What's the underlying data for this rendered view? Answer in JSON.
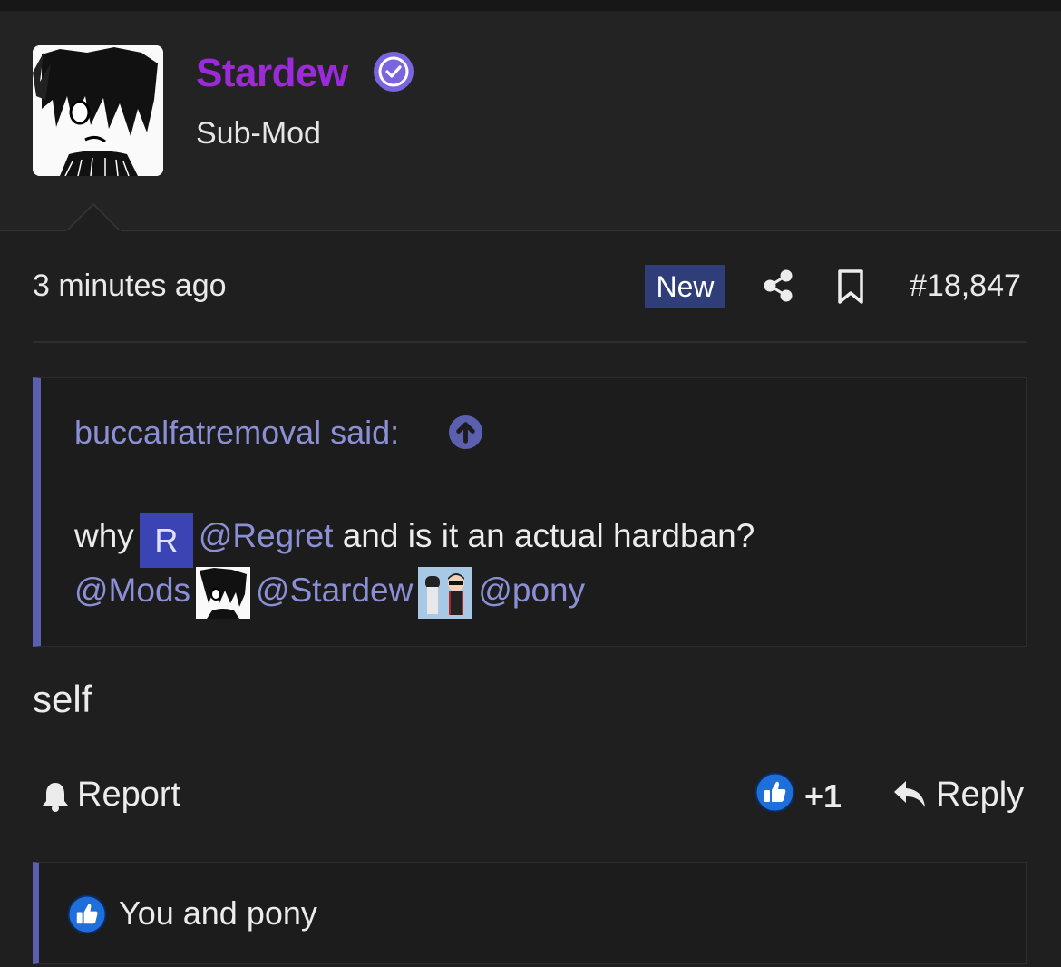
{
  "user": {
    "name": "Stardew",
    "title": "Sub-Mod",
    "name_color": "#9b2ad8",
    "verified_icon": "verified-check-icon"
  },
  "meta": {
    "time": "3 minutes ago",
    "badge": "New",
    "post_number": "#18,847",
    "badge_color": "#2f3e79"
  },
  "quote": {
    "author_line": "buccalfatremoval said:",
    "line1_before": "why",
    "mention_regret_avatar": "R",
    "mention_regret": "@Regret",
    "line1_after": "and is it an actual hardban?",
    "mention_mods": "@Mods",
    "mention_stardew": "@Stardew",
    "mention_pony": "@pony",
    "accent_color": "#5b5fb0",
    "mention_color": "#8b8fd6"
  },
  "post": {
    "body": "self"
  },
  "actions": {
    "report": "Report",
    "like_count": "+1",
    "reply": "Reply"
  },
  "reactions": {
    "summary": "You and pony"
  }
}
